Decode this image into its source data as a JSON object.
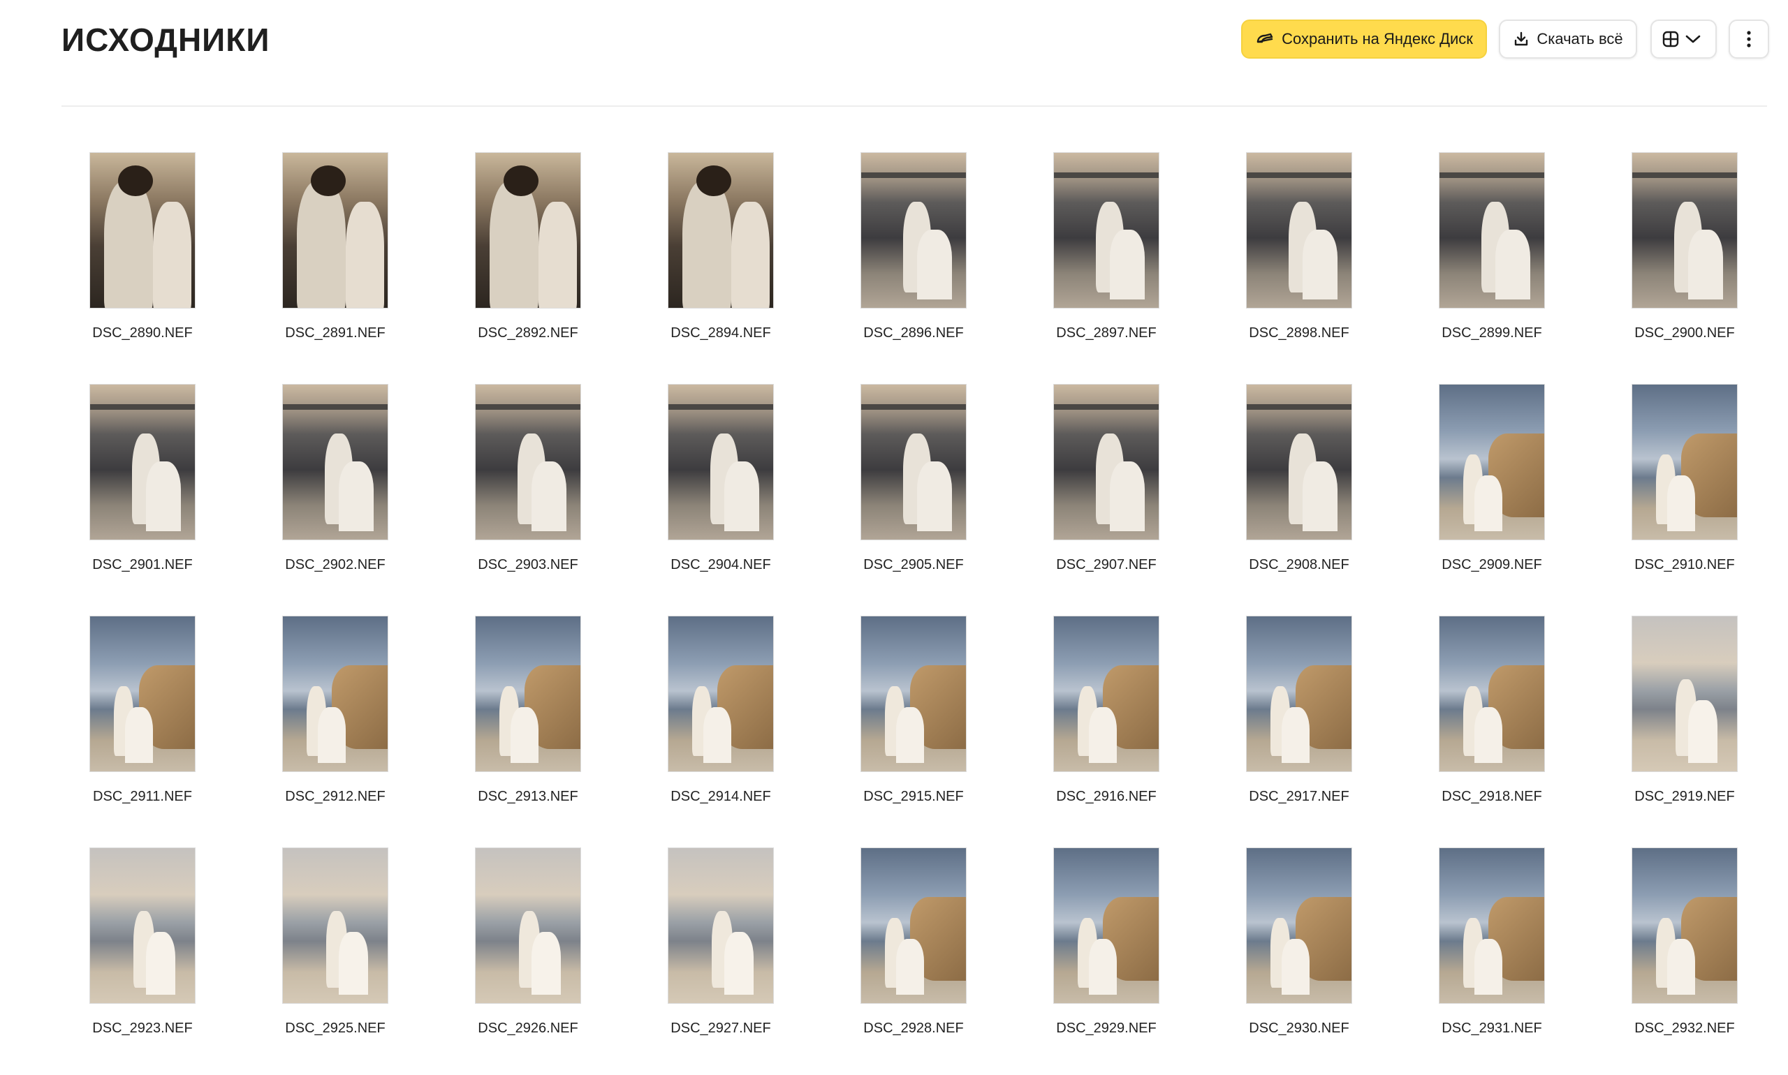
{
  "header": {
    "title": "ИСХОДНИКИ",
    "save_label": "Сохранить на Яндекс Диск",
    "download_label": "Скачать всё"
  },
  "colors": {
    "accent": "#ffdb4d",
    "divider": "#eeeeee"
  },
  "icons": {
    "save": "disk-icon",
    "download": "download-icon",
    "view": "grid-view-icon",
    "chevron": "chevron-down-icon",
    "more": "more-vertical-icon"
  },
  "files": [
    {
      "name": "DSC_2890.NEF",
      "style": "portrait"
    },
    {
      "name": "DSC_2891.NEF",
      "style": "portrait"
    },
    {
      "name": "DSC_2892.NEF",
      "style": "portrait"
    },
    {
      "name": "DSC_2894.NEF",
      "style": "portrait"
    },
    {
      "name": "DSC_2896.NEF",
      "style": "sunset"
    },
    {
      "name": "DSC_2897.NEF",
      "style": "sunset"
    },
    {
      "name": "DSC_2898.NEF",
      "style": "sunset"
    },
    {
      "name": "DSC_2899.NEF",
      "style": "sunset"
    },
    {
      "name": "DSC_2900.NEF",
      "style": "sunset"
    },
    {
      "name": "DSC_2901.NEF",
      "style": "sunset"
    },
    {
      "name": "DSC_2902.NEF",
      "style": "sunset"
    },
    {
      "name": "DSC_2903.NEF",
      "style": "sunset"
    },
    {
      "name": "DSC_2904.NEF",
      "style": "sunset"
    },
    {
      "name": "DSC_2905.NEF",
      "style": "sunset"
    },
    {
      "name": "DSC_2907.NEF",
      "style": "sunset"
    },
    {
      "name": "DSC_2908.NEF",
      "style": "sunset"
    },
    {
      "name": "DSC_2909.NEF",
      "style": "cliff"
    },
    {
      "name": "DSC_2910.NEF",
      "style": "cliff"
    },
    {
      "name": "DSC_2911.NEF",
      "style": "cliff"
    },
    {
      "name": "DSC_2912.NEF",
      "style": "cliff"
    },
    {
      "name": "DSC_2913.NEF",
      "style": "cliff"
    },
    {
      "name": "DSC_2914.NEF",
      "style": "cliff"
    },
    {
      "name": "DSC_2915.NEF",
      "style": "cliff"
    },
    {
      "name": "DSC_2916.NEF",
      "style": "cliff"
    },
    {
      "name": "DSC_2917.NEF",
      "style": "cliff"
    },
    {
      "name": "DSC_2918.NEF",
      "style": "cliff"
    },
    {
      "name": "DSC_2919.NEF",
      "style": "haze"
    },
    {
      "name": "DSC_2923.NEF",
      "style": "haze"
    },
    {
      "name": "DSC_2925.NEF",
      "style": "haze"
    },
    {
      "name": "DSC_2926.NEF",
      "style": "haze"
    },
    {
      "name": "DSC_2927.NEF",
      "style": "haze"
    },
    {
      "name": "DSC_2928.NEF",
      "style": "cliff"
    },
    {
      "name": "DSC_2929.NEF",
      "style": "cliff"
    },
    {
      "name": "DSC_2930.NEF",
      "style": "cliff"
    },
    {
      "name": "DSC_2931.NEF",
      "style": "cliff"
    },
    {
      "name": "DSC_2932.NEF",
      "style": "cliff"
    }
  ]
}
